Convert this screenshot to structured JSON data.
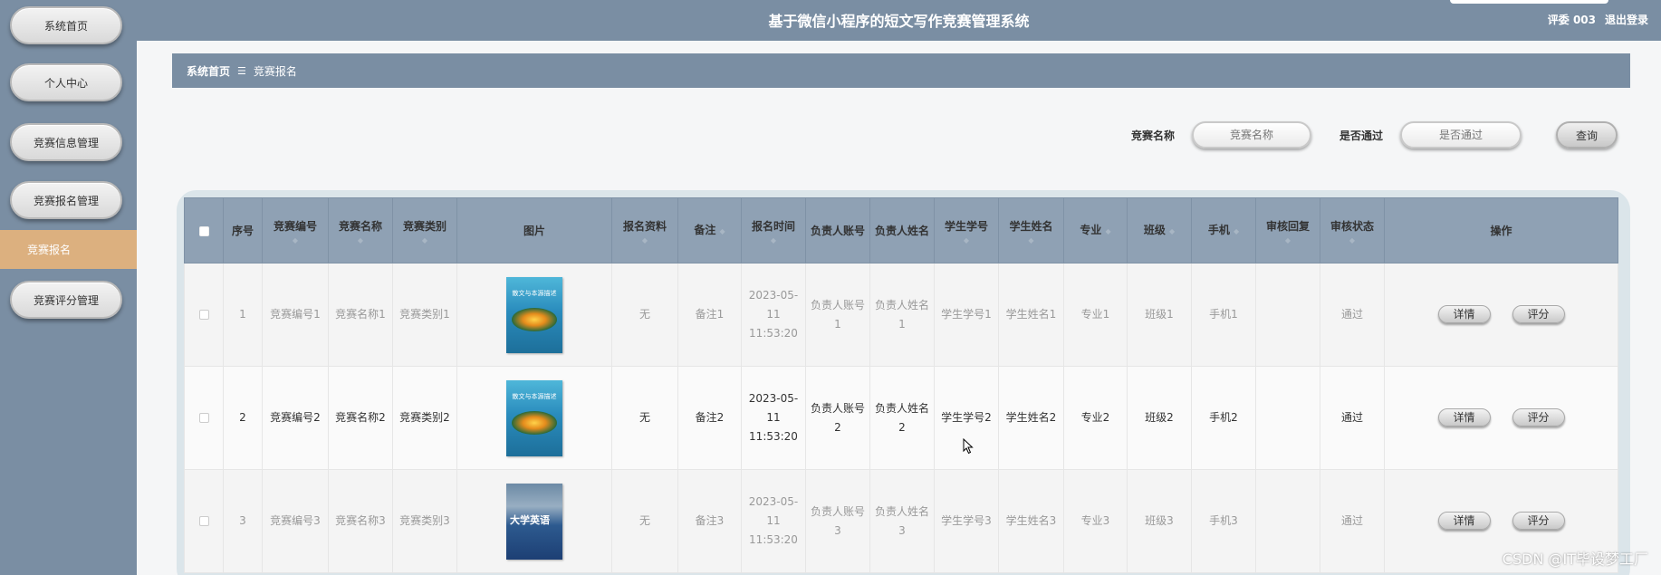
{
  "header": {
    "title": "基于微信小程序的短文写作竞赛管理系统",
    "user": "评委 003",
    "logout": "退出登录"
  },
  "sidebar": {
    "items": [
      {
        "label": "系统首页"
      },
      {
        "label": "个人中心"
      },
      {
        "label": "竞赛信息管理"
      },
      {
        "label": "竞赛报名管理"
      },
      {
        "label": "竞赛报名"
      },
      {
        "label": "竞赛评分管理"
      }
    ]
  },
  "breadcrumb": {
    "home": "系统首页",
    "separator": "☰",
    "current": "竞赛报名"
  },
  "search": {
    "name_label": "竞赛名称",
    "name_placeholder": "竞赛名称",
    "pass_label": "是否通过",
    "pass_placeholder": "是否通过",
    "query_button": "查询"
  },
  "table": {
    "columns": [
      "序号",
      "竞赛编号",
      "竞赛名称",
      "竞赛类别",
      "图片",
      "报名资料",
      "备注",
      "报名时间",
      "负责人账号",
      "负责人姓名",
      "学生学号",
      "学生姓名",
      "专业",
      "班级",
      "手机",
      "审核回复",
      "审核状态",
      "操作"
    ],
    "rows": [
      {
        "index": "1",
        "code": "竞赛编号1",
        "name": "竞赛名称1",
        "category": "竞赛类别1",
        "cover": "book-blue",
        "cover_text": "散文与本源描述",
        "material": "无",
        "remark": "备注1",
        "time": "2023-05-11 11:53:20",
        "manager_account": "负责人账号1",
        "manager_name": "负责人姓名1",
        "student_id": "学生学号1",
        "student_name": "学生姓名1",
        "major": "专业1",
        "class": "班级1",
        "phone": "手机1",
        "reply": "",
        "status": "通过"
      },
      {
        "index": "2",
        "code": "竞赛编号2",
        "name": "竞赛名称2",
        "category": "竞赛类别2",
        "cover": "book-blue",
        "cover_text": "散文与本源描述",
        "material": "无",
        "remark": "备注2",
        "time": "2023-05-11 11:53:20",
        "manager_account": "负责人账号2",
        "manager_name": "负责人姓名2",
        "student_id": "学生学号2",
        "student_name": "学生姓名2",
        "major": "专业2",
        "class": "班级2",
        "phone": "手机2",
        "reply": "",
        "status": "通过"
      },
      {
        "index": "3",
        "code": "竞赛编号3",
        "name": "竞赛名称3",
        "category": "竞赛类别3",
        "cover": "book-english",
        "cover_text": "大学英语",
        "material": "无",
        "remark": "备注3",
        "time": "2023-05-11 11:53:20",
        "manager_account": "负责人账号3",
        "manager_name": "负责人姓名3",
        "student_id": "学生学号3",
        "student_name": "学生姓名3",
        "major": "专业3",
        "class": "班级3",
        "phone": "手机3",
        "reply": "",
        "status": "通过"
      }
    ],
    "detail_button": "详情",
    "score_button": "评分"
  },
  "watermark": "CSDN @IT毕设梦工厂",
  "colors": {
    "header_bg": "#7a8ea3",
    "active_menu": "#dcb07f",
    "table_header": "#8fa1b4"
  }
}
